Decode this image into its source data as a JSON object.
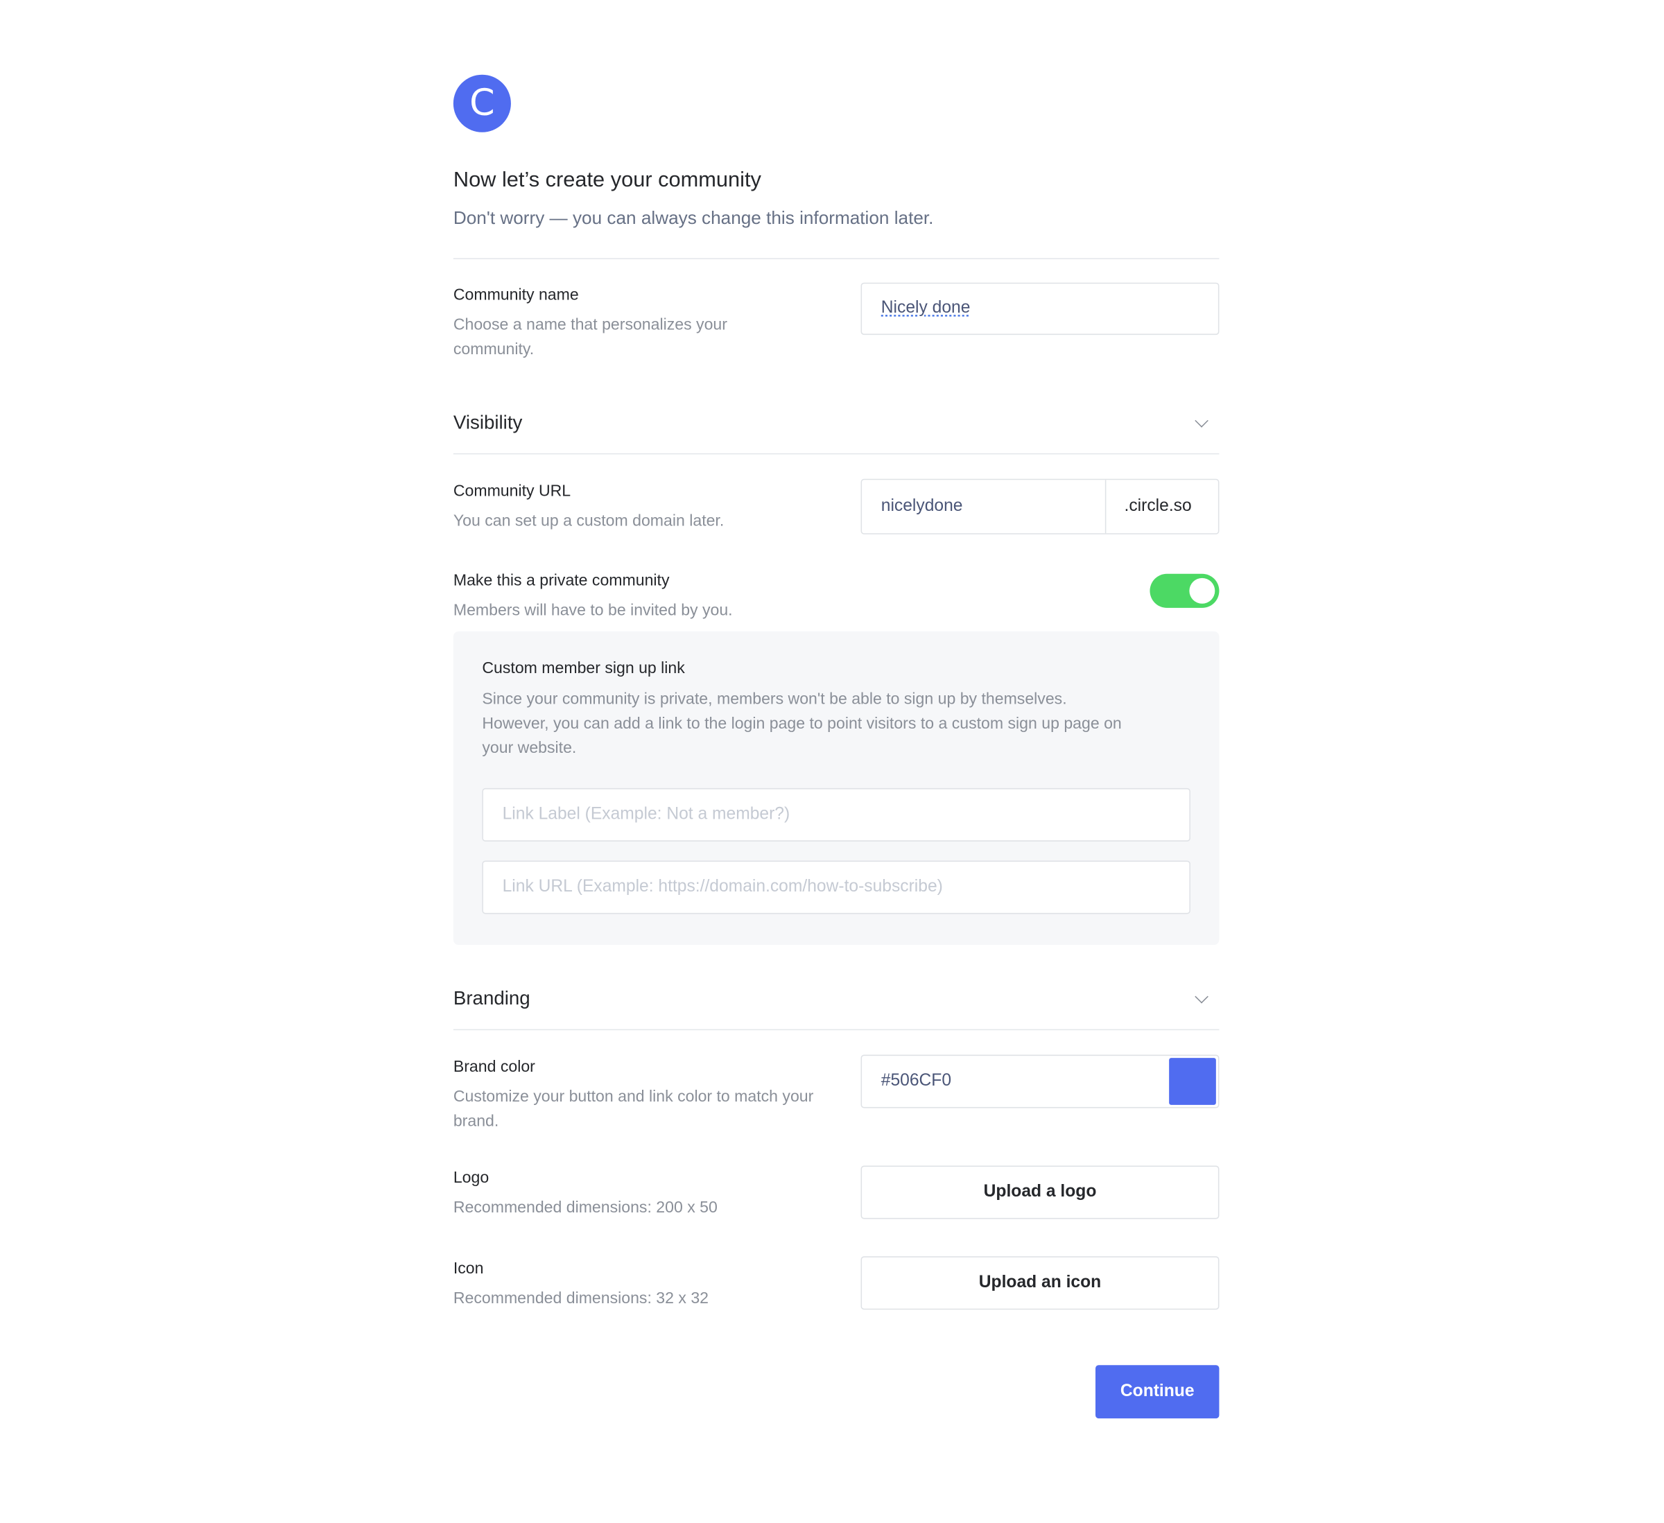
{
  "brand": {
    "logo_letter": "C",
    "accent_color": "#506CF0"
  },
  "header": {
    "title": "Now let’s create your community",
    "subtitle": "Don't worry — you can always change this information later."
  },
  "community_name": {
    "label": "Community name",
    "description": "Choose a name that personalizes your community.",
    "value": "Nicely done"
  },
  "visibility": {
    "section_title": "Visibility",
    "chevron_icon": "chevron-down-icon",
    "url": {
      "label": "Community URL",
      "description": "You can set up a custom domain later.",
      "value": "nicelydone",
      "suffix": ".circle.so"
    },
    "private": {
      "label": "Make this a private community",
      "description": "Members will have to be invited by you.",
      "enabled": true,
      "toggle_color": "#4CD964"
    },
    "custom_signup": {
      "title": "Custom member sign up link",
      "description": "Since your community is private, members won't be able to sign up by themselves. However, you can add a link to the login page to point visitors to a custom sign up page on your website.",
      "link_label_placeholder": "Link Label (Example: Not a member?)",
      "link_url_placeholder": "Link URL (Example: https://domain.com/how-to-subscribe)"
    }
  },
  "branding": {
    "section_title": "Branding",
    "chevron_icon": "chevron-down-icon",
    "brand_color": {
      "label": "Brand color",
      "description": "Customize your button and link color to match your brand.",
      "value": "#506CF0",
      "swatch_color": "#506CF0"
    },
    "logo": {
      "label": "Logo",
      "description": "Recommended dimensions: 200 x 50",
      "button_label": "Upload a logo"
    },
    "icon": {
      "label": "Icon",
      "description": "Recommended dimensions: 32 x 32",
      "button_label": "Upload an icon"
    }
  },
  "footer": {
    "continue_label": "Continue"
  }
}
